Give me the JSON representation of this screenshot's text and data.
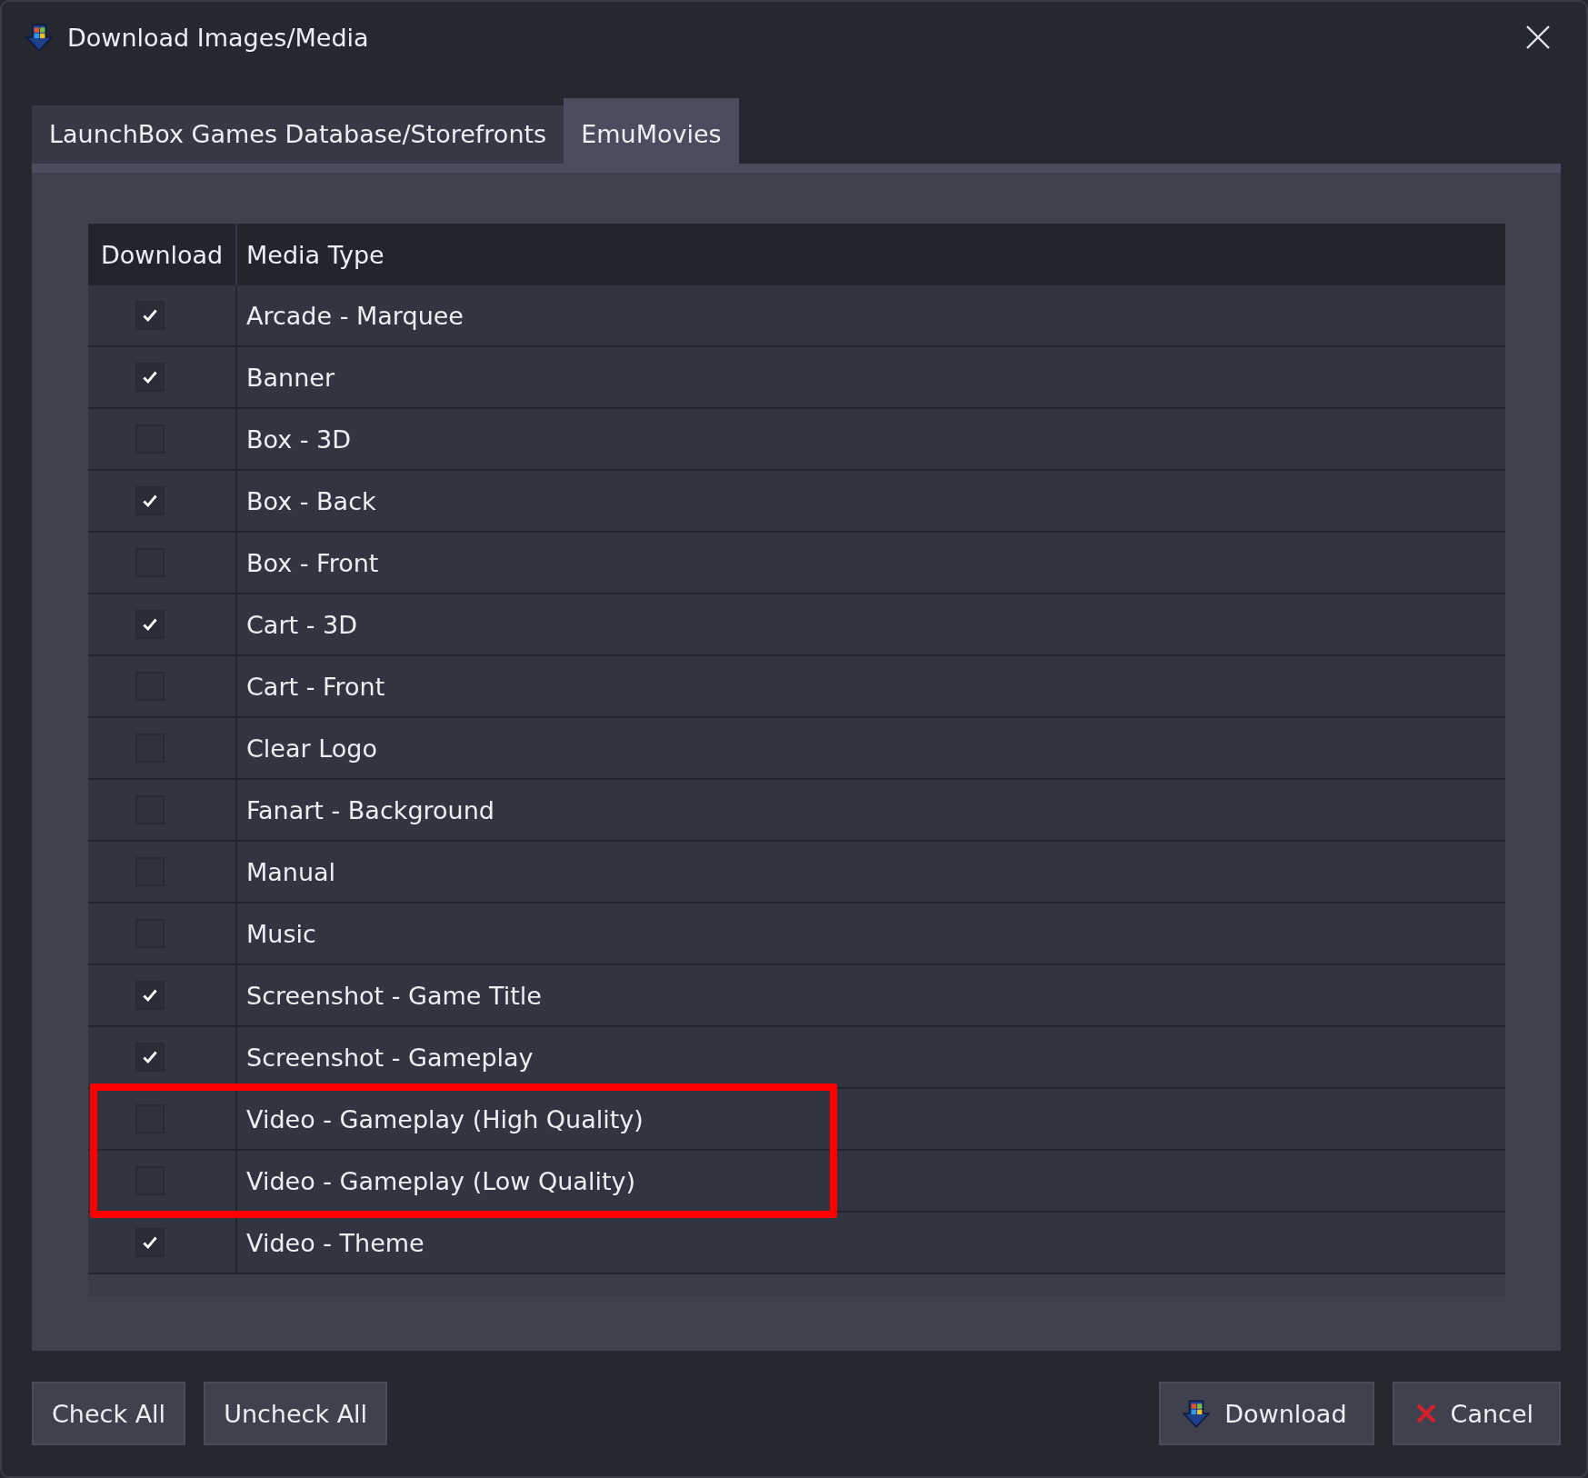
{
  "window": {
    "title": "Download Images/Media"
  },
  "tabs": [
    {
      "label": "LaunchBox Games Database/Storefronts",
      "selected": false
    },
    {
      "label": "EmuMovies",
      "selected": true
    }
  ],
  "table": {
    "columns": [
      "Download",
      "Media Type"
    ],
    "rows": [
      {
        "media_type": "Arcade - Marquee",
        "checked": true,
        "highlighted": false
      },
      {
        "media_type": "Banner",
        "checked": true,
        "highlighted": false
      },
      {
        "media_type": "Box - 3D",
        "checked": false,
        "highlighted": false
      },
      {
        "media_type": "Box - Back",
        "checked": true,
        "highlighted": false
      },
      {
        "media_type": "Box - Front",
        "checked": false,
        "highlighted": false
      },
      {
        "media_type": "Cart - 3D",
        "checked": true,
        "highlighted": false
      },
      {
        "media_type": "Cart - Front",
        "checked": false,
        "highlighted": false
      },
      {
        "media_type": "Clear Logo",
        "checked": false,
        "highlighted": false
      },
      {
        "media_type": "Fanart - Background",
        "checked": false,
        "highlighted": false
      },
      {
        "media_type": "Manual",
        "checked": false,
        "highlighted": false
      },
      {
        "media_type": "Music",
        "checked": false,
        "highlighted": false
      },
      {
        "media_type": "Screenshot - Game Title",
        "checked": true,
        "highlighted": false
      },
      {
        "media_type": "Screenshot - Gameplay",
        "checked": true,
        "highlighted": false
      },
      {
        "media_type": "Video - Gameplay (High Quality)",
        "checked": false,
        "highlighted": true
      },
      {
        "media_type": "Video - Gameplay (Low Quality)",
        "checked": false,
        "highlighted": true
      },
      {
        "media_type": "Video - Theme",
        "checked": true,
        "highlighted": false
      }
    ]
  },
  "buttons_left": [
    "Check All",
    "Uncheck All"
  ],
  "buttons_right": [
    {
      "label": "Download",
      "kind": "download"
    },
    {
      "label": "Cancel",
      "kind": "cancel"
    }
  ]
}
